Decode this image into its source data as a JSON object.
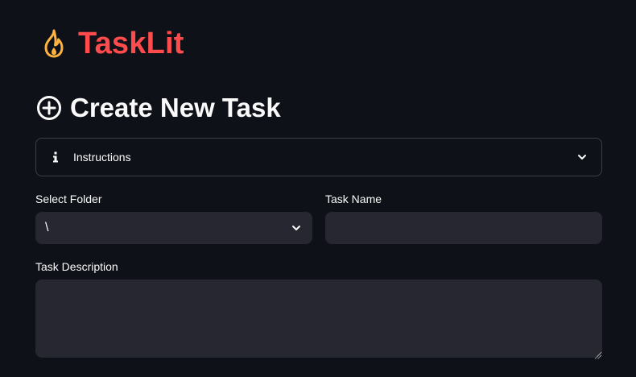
{
  "app": {
    "title": "TaskLit",
    "icon": "fire-icon",
    "brand_color": "#ff4b4b",
    "icon_color": "#ffb33f"
  },
  "page": {
    "heading": "Create New Task",
    "heading_icon": "add-circle-icon"
  },
  "instructions": {
    "label": "Instructions",
    "icon": "info-icon",
    "expanded": false
  },
  "form": {
    "folder": {
      "label": "Select Folder",
      "value": "\\"
    },
    "task_name": {
      "label": "Task Name",
      "value": "",
      "placeholder": ""
    },
    "task_description": {
      "label": "Task Description",
      "value": "",
      "placeholder": ""
    }
  },
  "colors": {
    "background": "#0e1117",
    "input_background": "#262730",
    "text": "#fafafa"
  }
}
